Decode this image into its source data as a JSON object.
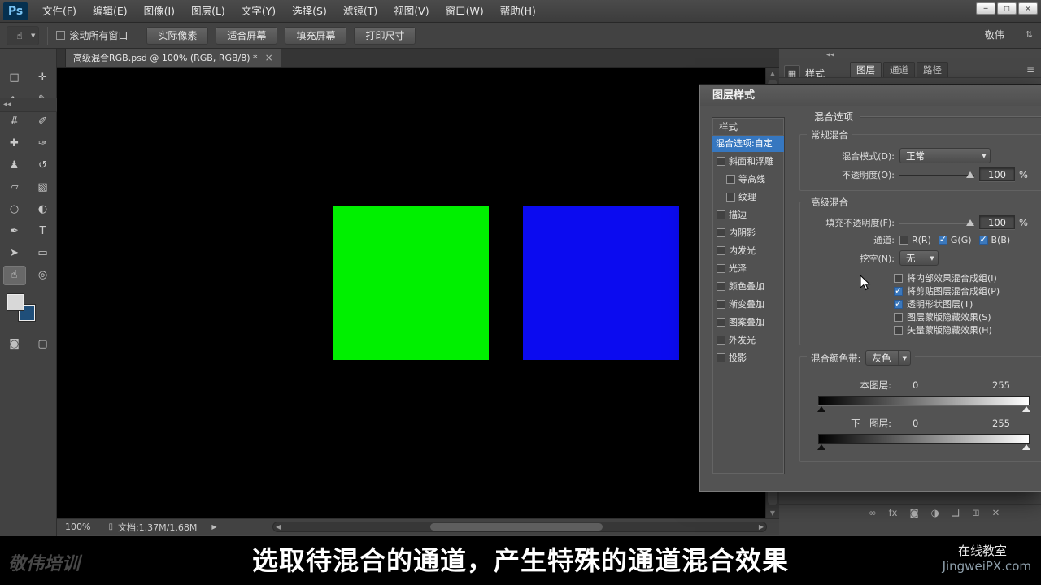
{
  "menubar": {
    "logo": "Ps",
    "items": [
      "文件(F)",
      "编辑(E)",
      "图像(I)",
      "图层(L)",
      "文字(Y)",
      "选择(S)",
      "滤镜(T)",
      "视图(V)",
      "窗口(W)",
      "帮助(H)"
    ],
    "window_controls": [
      {
        "name": "minimize-button",
        "glyph": "─"
      },
      {
        "name": "maximize-button",
        "glyph": "□"
      },
      {
        "name": "close-button",
        "glyph": "×"
      }
    ]
  },
  "options_bar": {
    "tool_icon": "☝",
    "scroll_all_windows": "滚动所有窗口",
    "buttons": [
      "实际像素",
      "适合屏幕",
      "填充屏幕",
      "打印尺寸"
    ],
    "workspace": "敬伟",
    "spinner": "⇅"
  },
  "tools_dock": {
    "collapse": "◂◂"
  },
  "tools": [
    {
      "name": "rectangular-marquee-tool",
      "glyph": "□"
    },
    {
      "name": "move-tool",
      "glyph": "✛"
    },
    {
      "name": "lasso-tool",
      "glyph": "∿"
    },
    {
      "name": "quick-selection-tool",
      "glyph": "✎"
    },
    {
      "name": "crop-tool",
      "glyph": "#"
    },
    {
      "name": "eyedropper-tool",
      "glyph": "✐"
    },
    {
      "name": "spot-healing-brush-tool",
      "glyph": "✚"
    },
    {
      "name": "brush-tool",
      "glyph": "✑"
    },
    {
      "name": "clone-stamp-tool",
      "glyph": "♟"
    },
    {
      "name": "history-brush-tool",
      "glyph": "↺"
    },
    {
      "name": "eraser-tool",
      "glyph": "▱"
    },
    {
      "name": "gradient-tool",
      "glyph": "▧"
    },
    {
      "name": "blur-tool",
      "glyph": "○"
    },
    {
      "name": "dodge-tool",
      "glyph": "◐"
    },
    {
      "name": "pen-tool",
      "glyph": "✒"
    },
    {
      "name": "type-tool",
      "glyph": "T"
    },
    {
      "name": "path-selection-tool",
      "glyph": "➤"
    },
    {
      "name": "shape-tool",
      "glyph": "▭"
    },
    {
      "name": "hand-tool",
      "glyph": "☝",
      "selected": true
    },
    {
      "name": "zoom-tool",
      "glyph": "◎"
    }
  ],
  "swatches": {
    "foreground": "#d8d8d8",
    "background": "#1f4e79"
  },
  "tool_extras": [
    {
      "name": "quick-mask-button",
      "glyph": "◙"
    },
    {
      "name": "screen-mode-button",
      "glyph": "▢"
    }
  ],
  "document_tab": {
    "title": "高级混合RGB.psd @ 100% (RGB, RGB/8) *",
    "close": "×"
  },
  "canvas": {
    "squares": [
      {
        "name": "green-square",
        "color": "#00f000"
      },
      {
        "name": "blue-square",
        "color": "#0b0bf0"
      }
    ]
  },
  "status_bar": {
    "zoom": "100%",
    "doc_icon": "▯",
    "doc_info": "文档:1.37M/1.68M",
    "menu_arrow": "▶",
    "scroll_left": "◀",
    "scroll_right": "▶",
    "scroll_up": "▲",
    "scroll_down": "▼"
  },
  "right_dock": {
    "collapse": "◂◂",
    "collapsed_panel": {
      "icon": "▦",
      "label": "样式"
    },
    "tabs": [
      {
        "label": "图层",
        "active": true
      },
      {
        "label": "通道"
      },
      {
        "label": "路径"
      }
    ],
    "panel_menu": "≡",
    "footer_icons": [
      {
        "name": "link-layers-icon",
        "glyph": "∞"
      },
      {
        "name": "layer-effects-icon",
        "glyph": "fx"
      },
      {
        "name": "add-layer-mask-icon",
        "glyph": "◙"
      },
      {
        "name": "adjustment-layer-icon",
        "glyph": "◑"
      },
      {
        "name": "layer-group-icon",
        "glyph": "❏"
      },
      {
        "name": "new-layer-icon",
        "glyph": "⊞"
      },
      {
        "name": "delete-layer-icon",
        "glyph": "✕"
      }
    ]
  },
  "dialog": {
    "title": "图层样式",
    "styles_list": {
      "header": "样式",
      "selected": "混合选项:自定",
      "items": [
        {
          "label": "斜面和浮雕"
        },
        {
          "label": "等高线",
          "indent": true
        },
        {
          "label": "纹理",
          "indent": true
        },
        {
          "label": "描边"
        },
        {
          "label": "内阴影"
        },
        {
          "label": "内发光"
        },
        {
          "label": "光泽"
        },
        {
          "label": "颜色叠加"
        },
        {
          "label": "渐变叠加"
        },
        {
          "label": "图案叠加"
        },
        {
          "label": "外发光"
        },
        {
          "label": "投影"
        }
      ]
    },
    "section_header": "混合选项",
    "general": {
      "legend": "常规混合",
      "blend_mode_label": "混合模式(D):",
      "blend_mode_value": "正常",
      "opacity_label": "不透明度(O):",
      "opacity_value": "100",
      "percent": "%"
    },
    "advanced": {
      "legend": "高级混合",
      "fill_label": "填充不透明度(F):",
      "fill_value": "100",
      "percent": "%",
      "channels_label": "通道:",
      "channels": [
        {
          "label": "R(R)",
          "checked": false
        },
        {
          "label": "G(G)",
          "checked": true
        },
        {
          "label": "B(B)",
          "checked": true
        }
      ],
      "knockout_label": "挖空(N):",
      "knockout_value": "无",
      "checks": [
        {
          "label": "将内部效果混合成组(I)"
        },
        {
          "label": "将剪贴图层混合成组(P)",
          "checked": true
        },
        {
          "label": "透明形状图层(T)",
          "checked": true
        },
        {
          "label": "图层蒙版隐藏效果(S)"
        },
        {
          "label": "矢量蒙版隐藏效果(H)"
        }
      ]
    },
    "blend_if": {
      "legend": "混合颜色带:",
      "mode": "灰色",
      "this_layer_label": "本图层:",
      "this_min": "0",
      "this_max": "255",
      "under_label": "下一图层:",
      "under_min": "0",
      "under_max": "255"
    }
  },
  "banner": {
    "subtitle": "选取待混合的通道，产生特殊的通道混合效果",
    "brand": "敬伟培训",
    "right_top": "在线教室",
    "right_bottom": "JingweiPX.com"
  }
}
